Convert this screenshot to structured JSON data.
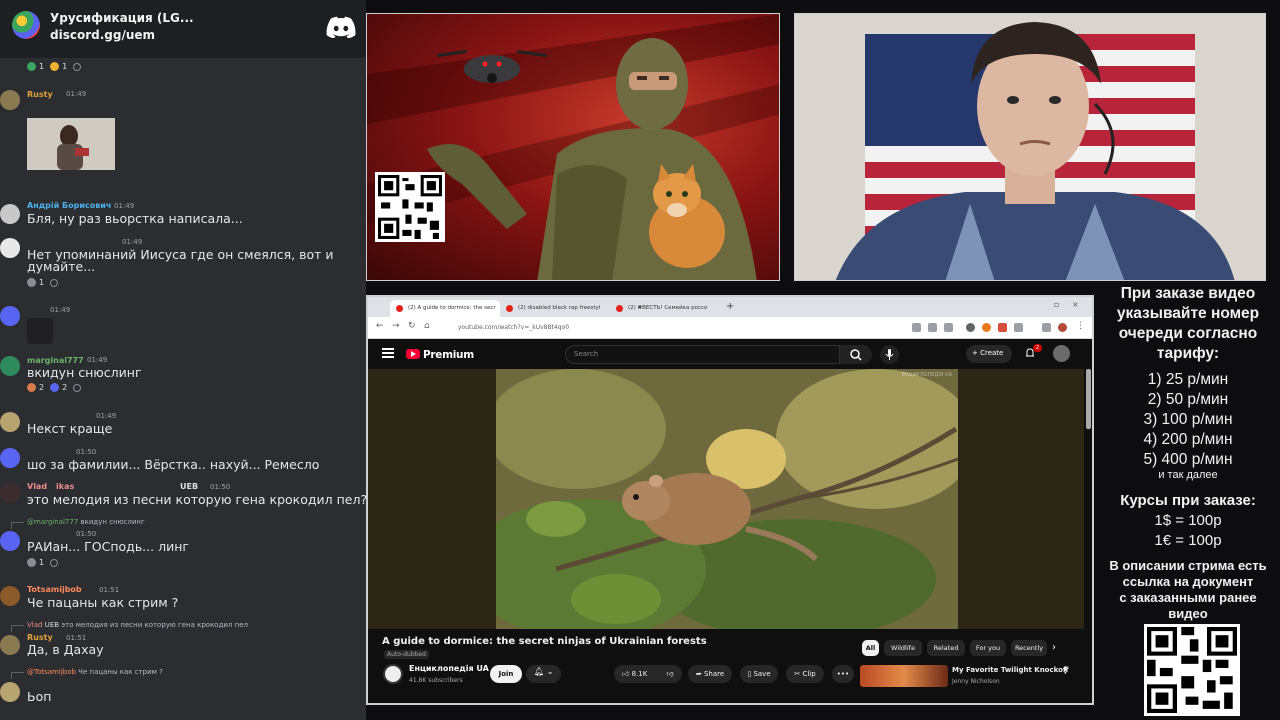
{
  "discord": {
    "server_name": "Урусификация (LG...",
    "invite": "discord.gg/uem",
    "messages": [
      {
        "author": "Rusty",
        "time": "01:49",
        "text": "",
        "color": "#e0a23a"
      },
      {
        "author": "Андрій Борисович",
        "time": "01:49",
        "text": "Бля, ну раз вьорстка написала...",
        "color": "#4fb0e8"
      },
      {
        "author": "",
        "time": "01:49",
        "text_line1": "Нет упоминаний Иисуса где он смеялся, вот и",
        "text_line2": "думайте..."
      },
      {
        "author": "",
        "time": "01:49",
        "text": ""
      },
      {
        "author": "marginal777",
        "time": "01:49",
        "text": "вкидун снюслинг",
        "color": "#6db36b"
      },
      {
        "author": "",
        "time": "01:49",
        "text": "Некст краще"
      },
      {
        "author": "",
        "time": "01:50",
        "text": "шо за фамилии... Вёрстка.. нахуй... Ремесло"
      },
      {
        "author": "Vlad",
        "author_tail": "ikas",
        "time": "01:50",
        "text": "это мелодия из песни которую гена крокодил пел?",
        "color": "#ed8b8b",
        "tag": "UEB"
      },
      {
        "reply": "вкидун снюслинг",
        "time": "01:50",
        "text": "РАИан... ГОСподь... линг"
      },
      {
        "author": "Totsamijbob",
        "time": "01:51",
        "text": "Че пацаны как стрим ?",
        "color": "#ff8a5c"
      },
      {
        "reply": "это мелодия из песни которую гена крокодил пел",
        "reply_author": "Vlad",
        "reply_tag": "UEB",
        "author": "Rusty",
        "time": "01:51",
        "text": "Да, в Дахау"
      },
      {
        "reply": "Че пацаны как стрим ?",
        "reply_author": "@Totsamijbob",
        "text": "Ьоп"
      }
    ],
    "reactions": {
      "top": [
        "1",
        "1"
      ],
      "jesus": [
        "1"
      ],
      "marginal": [
        "2",
        "2"
      ],
      "raian": [
        "1"
      ]
    }
  },
  "browser": {
    "tabs": [
      {
        "label": "(2) A guide to dormice: the secr",
        "active": true
      },
      {
        "label": "(2) disabled black rap freestyl",
        "active": false
      },
      {
        "label": "(2) ✖ВЕСТЬ! Семейка россо",
        "active": false
      }
    ],
    "url": "youtube.com/watch?v=_kUv8Bt4qo0"
  },
  "youtube": {
    "brand": "Premium",
    "search_placeholder": "Search",
    "create_label": "Create",
    "notif_count": "2",
    "video_title": "A guide to dormice: the secret ninjas of Ukrainian forests",
    "auto_dubbed": "Auto-dubbed",
    "channel_name": "Енциклопедія UA",
    "subscribers": "41.8K subscribers",
    "join_label": "Join",
    "likes": "8.1K",
    "share_label": "Share",
    "save_label": "Save",
    "clip_label": "Clip",
    "more_label": "•••",
    "chips": [
      "All",
      "Wildlife",
      "Related",
      "For you",
      "Recently"
    ],
    "rec_title": "My Favorite Twilight Knockoff",
    "rec_channel": "Jenny Nicholson",
    "watermark": "ЕНЦИКЛОПЕДІЯ UA"
  },
  "info": {
    "heading": [
      "При заказе видео",
      "указывайте номер",
      "очереди согласно",
      "тарифу:"
    ],
    "tariffs": [
      "1) 25 р/мин",
      "2) 50 р/мин",
      "3) 100 р/мин",
      "4) 200 р/мин",
      "5) 400 р/мин"
    ],
    "etc": "и так далее",
    "courses_title": "Курсы при заказе:",
    "rates": [
      "1$ = 100р",
      "1€ = 100р"
    ],
    "description": [
      "В описании стрима есть",
      "ссылка на документ",
      "с заказанными ранее",
      "видео"
    ]
  },
  "colors": {
    "discord_bg": "#2b2d31",
    "youtube_red": "#ff0033"
  }
}
